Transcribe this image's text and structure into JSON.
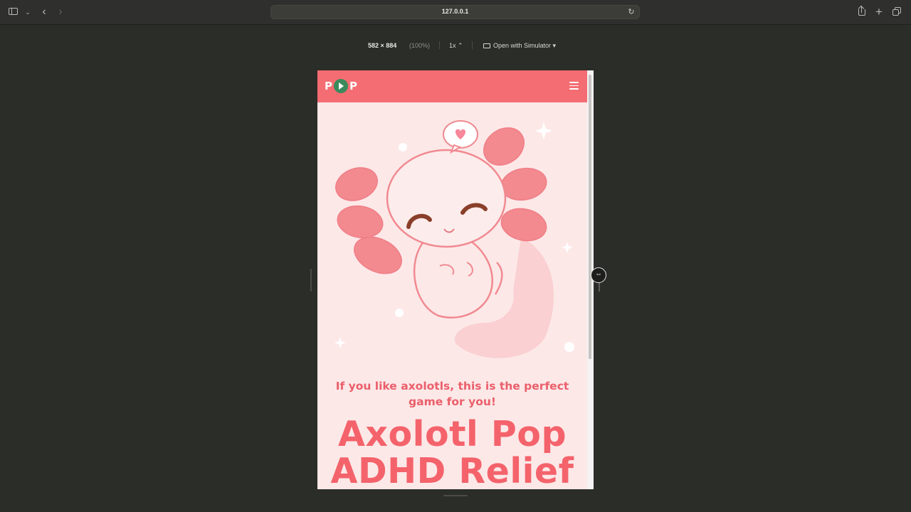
{
  "browser": {
    "url": "127.0.0.1",
    "back_label": "‹",
    "forward_label": "›",
    "reload_label": "↻",
    "new_tab_label": "+"
  },
  "responsive_bar": {
    "size": "582 × 884",
    "zoom": "(100%)",
    "scale": "1x ⌃",
    "open_with": "Open with Simulator ▾"
  },
  "site": {
    "logo_left": "P",
    "logo_right": "P",
    "tagline": "If you like axolotls, this is the perfect game for you!",
    "title_line1": "Axolotl Pop",
    "title_line2": "ADHD Relief",
    "colors": {
      "header": "#f46d72",
      "background": "#fde8e8",
      "logo_play": "#3a8a5c",
      "title": "#f4636b"
    }
  },
  "icons": {
    "sidebar": "sidebar-icon",
    "share": "share-icon",
    "tabs": "tab-overview-icon",
    "menu": "hamburger-menu-icon"
  }
}
